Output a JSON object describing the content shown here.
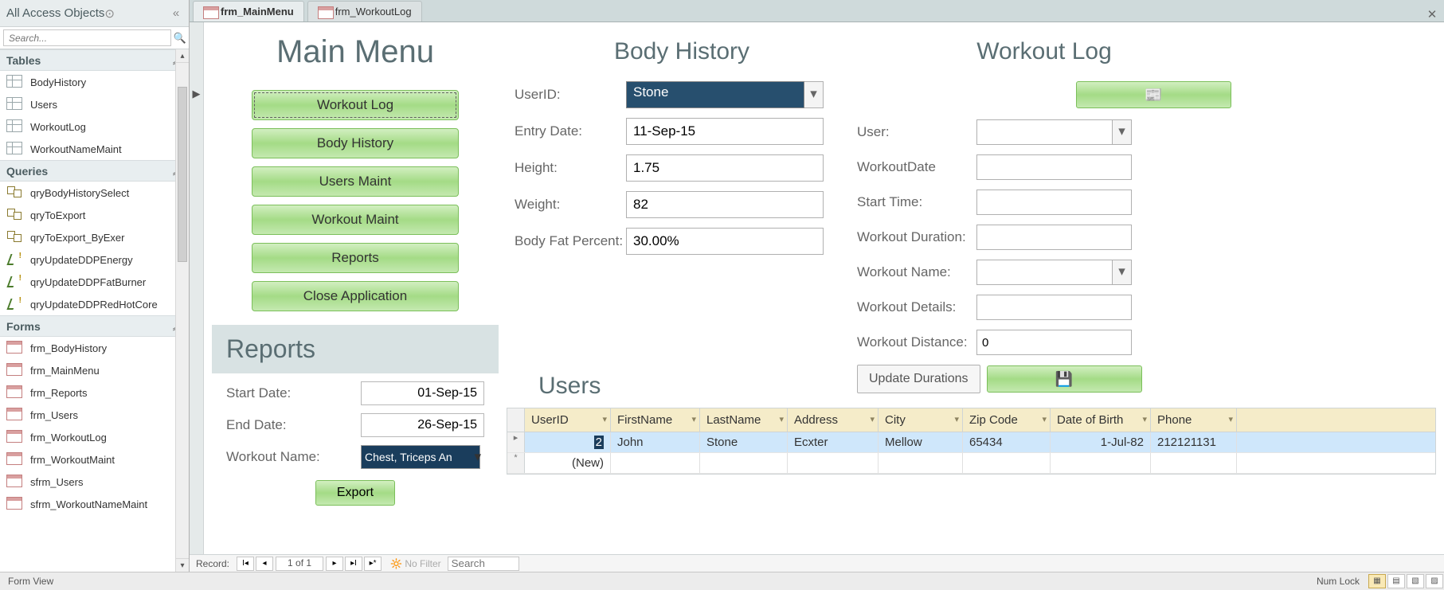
{
  "nav": {
    "title": "All Access Objects",
    "searchPlaceholder": "Search...",
    "groups": {
      "tables": {
        "label": "Tables",
        "items": [
          "BodyHistory",
          "Users",
          "WorkoutLog",
          "WorkoutNameMaint"
        ]
      },
      "queries": {
        "label": "Queries",
        "select": [
          "qryBodyHistorySelect",
          "qryToExport",
          "qryToExport_ByExer"
        ],
        "update": [
          "qryUpdateDDPEnergy",
          "qryUpdateDDPFatBurner",
          "qryUpdateDDPRedHotCore"
        ]
      },
      "forms": {
        "label": "Forms",
        "items": [
          "frm_BodyHistory",
          "frm_MainMenu",
          "frm_Reports",
          "frm_Users",
          "frm_WorkoutLog",
          "frm_WorkoutMaint",
          "sfrm_Users",
          "sfrm_WorkoutNameMaint"
        ]
      }
    }
  },
  "tabs": {
    "t1": "frm_MainMenu",
    "t2": "frm_WorkoutLog"
  },
  "mainMenu": {
    "title": "Main Menu",
    "btns": {
      "workoutLog": "Workout Log",
      "bodyHistory": "Body History",
      "usersMaint": "Users Maint",
      "workoutMaint": "Workout Maint",
      "reports": "Reports",
      "close": "Close Application"
    }
  },
  "reports": {
    "title": "Reports",
    "startLabel": "Start Date:",
    "startVal": "01-Sep-15",
    "endLabel": "End Date:",
    "endVal": "26-Sep-15",
    "wnLabel": "Workout Name:",
    "wnVal": "Chest, Triceps An",
    "exportLabel": "Export"
  },
  "bodyHistory": {
    "title": "Body History",
    "labels": {
      "userId": "UserID:",
      "entryDate": "Entry Date:",
      "height": "Height:",
      "weight": "Weight:",
      "bodyFat": "Body Fat Percent:"
    },
    "vals": {
      "userId": "Stone",
      "entryDate": "11-Sep-15",
      "height": "1.75",
      "weight": "82",
      "bodyFat": "30.00%"
    }
  },
  "workoutLog": {
    "title": "Workout Log",
    "labels": {
      "user": "User:",
      "wdate": "WorkoutDate",
      "stime": "Start Time:",
      "wdur": "Workout Duration:",
      "wname": "Workout Name:",
      "wdet": "Workout Details:",
      "wdist": "Workout Distance:"
    },
    "vals": {
      "user": "",
      "wdate": "",
      "stime": "",
      "wdur": "",
      "wname": "",
      "wdet": "",
      "wdist": "0"
    },
    "updateBtn": "Update Durations",
    "newGlyph": "📰",
    "saveGlyph": "💾"
  },
  "users": {
    "title": "Users",
    "cols": {
      "uid": "UserID",
      "fn": "FirstName",
      "ln": "LastName",
      "ad": "Address",
      "ct": "City",
      "zp": "Zip Code",
      "db": "Date of Birth",
      "ph": "Phone"
    },
    "row1": {
      "uid": "2",
      "fn": "John",
      "ln": "Stone",
      "ad": "Ecxter",
      "ct": "Mellow",
      "zp": "65434",
      "db": "1-Jul-82",
      "ph": "212121131"
    },
    "newRow": "(New)"
  },
  "recnav": {
    "label": "Record:",
    "pos": "1 of 1",
    "nofilter": "No Filter",
    "searchPh": "Search"
  },
  "status": {
    "view": "Form View",
    "numlock": "Num Lock"
  }
}
